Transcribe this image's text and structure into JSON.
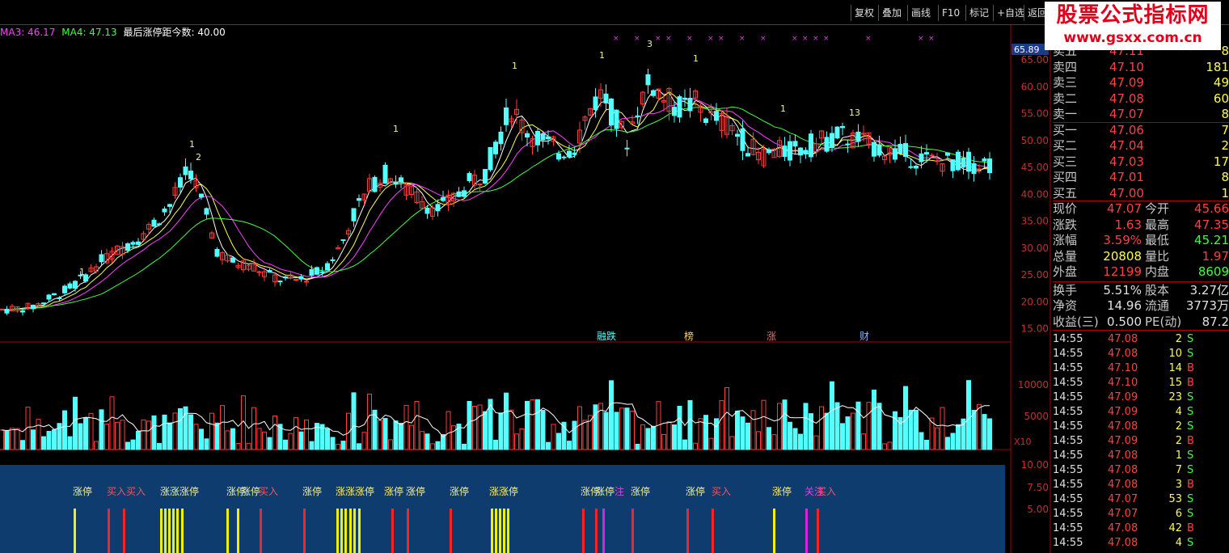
{
  "toolbar": {
    "buttons": [
      "复权",
      "叠加",
      "画线",
      "F10",
      "标记",
      "+自选",
      "返回"
    ]
  },
  "watermark": {
    "line1": "股票公式指标网",
    "line2": "www.gsxx.com.cn"
  },
  "ma_line": {
    "ma3": "MA3: 46.17",
    "ma4": "MA4: 47.13",
    "note": "最后涨停距今数: 40.00"
  },
  "price_axis": {
    "current": "65.89",
    "ticks": [
      "65.00",
      "60.00",
      "55.00",
      "50.00",
      "45.00",
      "40.00",
      "35.00",
      "30.00",
      "25.00",
      "20.00",
      "15.00"
    ]
  },
  "volume_axis": {
    "ticks": [
      "10000",
      "5000"
    ],
    "unit": "X10"
  },
  "signal_axis": {
    "ticks": [
      "10.00",
      "7.50",
      "5.00"
    ]
  },
  "events": [
    "融跌",
    "榜",
    "涨",
    "财"
  ],
  "signal_labels": [
    {
      "t": "涨停",
      "c": "#f7f07a"
    },
    {
      "t": "买入买入",
      "c": "#ff5050"
    },
    {
      "t": "涨涨涨停",
      "c": "#f7f07a"
    },
    {
      "t": "涨停",
      "c": "#f7f07a"
    },
    {
      "t": "涨停",
      "c": "#f7f07a"
    },
    {
      "t": "买入",
      "c": "#ff5050"
    },
    {
      "t": "涨停",
      "c": "#f7f07a"
    },
    {
      "t": "涨涨涨停",
      "c": "#f7f07a"
    },
    {
      "t": "涨停",
      "c": "#f7f07a"
    },
    {
      "t": "涨停",
      "c": "#f7f07a"
    },
    {
      "t": "涨停",
      "c": "#f7f07a"
    },
    {
      "t": "涨涨停",
      "c": "#f7f07a"
    },
    {
      "t": "涨停",
      "c": "#f7f07a"
    },
    {
      "t": "涨停",
      "c": "#f7f07a"
    },
    {
      "t": "注",
      "c": "#e040e0"
    },
    {
      "t": "涨停",
      "c": "#f7f07a"
    },
    {
      "t": "涨停",
      "c": "#f7f07a"
    },
    {
      "t": "买入",
      "c": "#ff5050"
    },
    {
      "t": "涨停",
      "c": "#f7f07a"
    },
    {
      "t": "关注",
      "c": "#e040e0"
    },
    {
      "t": "买入",
      "c": "#ff5050"
    }
  ],
  "quote": {
    "sell": [
      {
        "label": "卖五",
        "price": "47.11",
        "vol": "8"
      },
      {
        "label": "卖四",
        "price": "47.10",
        "vol": "181"
      },
      {
        "label": "卖三",
        "price": "47.09",
        "vol": "49"
      },
      {
        "label": "卖二",
        "price": "47.08",
        "vol": "60"
      },
      {
        "label": "卖一",
        "price": "47.07",
        "vol": "8"
      }
    ],
    "buy": [
      {
        "label": "买一",
        "price": "47.06",
        "vol": "7"
      },
      {
        "label": "买二",
        "price": "47.04",
        "vol": "2"
      },
      {
        "label": "买三",
        "price": "47.03",
        "vol": "17"
      },
      {
        "label": "买四",
        "price": "47.01",
        "vol": "8"
      },
      {
        "label": "买五",
        "price": "47.00",
        "vol": "1"
      }
    ],
    "stats": [
      {
        "l1": "现价",
        "v1": "47.07",
        "c1": "#ff4040",
        "l2": "今开",
        "v2": "45.66",
        "c2": "#ff4040"
      },
      {
        "l1": "涨跌",
        "v1": "1.63",
        "c1": "#ff4040",
        "l2": "最高",
        "v2": "47.35",
        "c2": "#ff4040"
      },
      {
        "l1": "涨幅",
        "v1": "3.59%",
        "c1": "#ff4040",
        "l2": "最低",
        "v2": "45.21",
        "c2": "#40ff40"
      },
      {
        "l1": "总量",
        "v1": "20808",
        "c1": "#ffff40",
        "l2": "量比",
        "v2": "1.97",
        "c2": "#ff4040"
      },
      {
        "l1": "外盘",
        "v1": "12199",
        "c1": "#ff4040",
        "l2": "内盘",
        "v2": "8609",
        "c2": "#40ff40"
      }
    ],
    "stats2": [
      {
        "l1": "换手",
        "v1": "5.51%",
        "l2": "股本",
        "v2": "3.27亿"
      },
      {
        "l1": "净资",
        "v1": "14.96",
        "l2": "流通",
        "v2": "3773万"
      },
      {
        "l1": "收益(三)",
        "v1": "0.500",
        "l2": "PE(动)",
        "v2": "87.2"
      }
    ]
  },
  "trades": [
    {
      "time": "14:55",
      "price": "47.08",
      "vol": "2",
      "bs": "S"
    },
    {
      "time": "14:55",
      "price": "47.08",
      "vol": "10",
      "bs": "S"
    },
    {
      "time": "14:55",
      "price": "47.10",
      "vol": "14",
      "bs": "B"
    },
    {
      "time": "14:55",
      "price": "47.10",
      "vol": "15",
      "bs": "B"
    },
    {
      "time": "14:55",
      "price": "47.09",
      "vol": "23",
      "bs": "S"
    },
    {
      "time": "14:55",
      "price": "47.09",
      "vol": "4",
      "bs": "S"
    },
    {
      "time": "14:55",
      "price": "47.08",
      "vol": "2",
      "bs": "S"
    },
    {
      "time": "14:55",
      "price": "47.09",
      "vol": "2",
      "bs": "B"
    },
    {
      "time": "14:55",
      "price": "47.08",
      "vol": "1",
      "bs": "S"
    },
    {
      "time": "14:55",
      "price": "47.08",
      "vol": "7",
      "bs": "S"
    },
    {
      "time": "14:55",
      "price": "47.08",
      "vol": "3",
      "bs": "B"
    },
    {
      "time": "14:55",
      "price": "47.07",
      "vol": "53",
      "bs": "S"
    },
    {
      "time": "14:55",
      "price": "47.07",
      "vol": "6",
      "bs": "S"
    },
    {
      "time": "14:55",
      "price": "47.08",
      "vol": "42",
      "bs": "B"
    },
    {
      "time": "14:55",
      "price": "47.08",
      "vol": "4",
      "bs": "S"
    }
  ],
  "colors": {
    "up": "#ff3c3c",
    "down": "#54ffff",
    "ma1": "#ffffff",
    "ma2": "#ffff50",
    "ma3": "#ff40ff",
    "ma4": "#40ff40",
    "signal_bg": "#0f3c6e",
    "limit_up_bar": "#f0f000",
    "buy_bar": "#ff2020",
    "watch_bar": "#e020e0"
  }
}
